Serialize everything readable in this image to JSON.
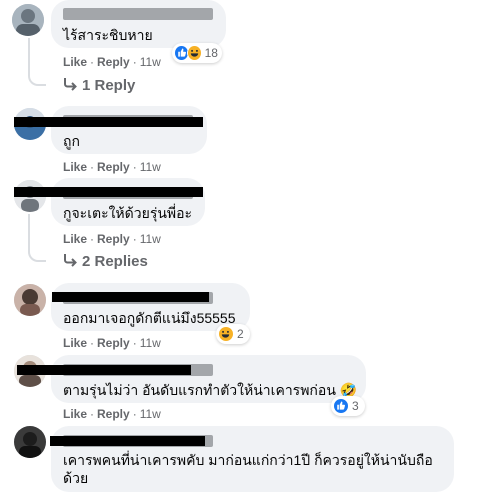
{
  "comments": [
    {
      "text": "ไร้สาระชิบหาย",
      "like_label": "Like",
      "reply_label": "Reply",
      "time": "11w",
      "reaction_count": "18",
      "reactions": [
        "like-icon",
        "haha-icon"
      ],
      "replies_label": "1 Reply"
    },
    {
      "text": "ถูก",
      "like_label": "Like",
      "reply_label": "Reply",
      "time": "11w"
    },
    {
      "text": "กูจะเตะให้ด้วยรุ่นพี่อะ",
      "like_label": "Like",
      "reply_label": "Reply",
      "time": "11w",
      "replies_label": "2 Replies"
    },
    {
      "text": "ออกมาเจอกูดักตีแน่มึง55555",
      "like_label": "Like",
      "reply_label": "Reply",
      "time": "11w",
      "reaction_count": "2",
      "reactions": [
        "haha-icon"
      ]
    },
    {
      "text": "ตามรุ่นไม่ว่า อันดับแรกทำตัวให้น่าเคารพก่อน 🤣",
      "like_label": "Like",
      "reply_label": "Reply",
      "time": "11w",
      "reaction_count": "3",
      "reactions": [
        "like-icon"
      ]
    },
    {
      "text_line1": "เคารพคนที่น่าเคารพคับ มาก่อนแก่กว่า1ปี ก็ควรอยู่ให้น่านับถือ",
      "text_line2": "ด้วย"
    }
  ],
  "colors": {
    "bubble": "#f0f2f5",
    "meta": "#65676b",
    "like_blue": "#1877f2",
    "haha_yellow": "#f7b125"
  }
}
